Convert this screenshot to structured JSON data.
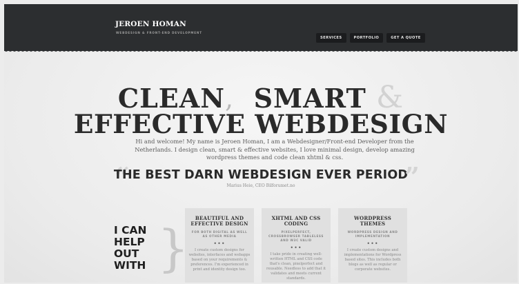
{
  "header": {
    "brand_name": "JEROEN HOMAN",
    "tagline": "WEBDESIGN & FRONT-END DEVELOPMENT",
    "nav": [
      "SERVICES",
      "PORTFOLIO",
      "GET A QUOTE"
    ]
  },
  "hero": {
    "line1_a": "CLEAN",
    "line1_comma": ",",
    "line1_b": "SMART",
    "line1_amp": "&",
    "line2": "EFFECTIVE WEBDESIGN",
    "intro": "Hi and welcome! My name is Jeroen Homan, I am a Webdesigner/Front-end Developer from the Netherlands. I design clean, smart & effective websites, I love minimal design, develop amazing wordpress themes and code clean xhtml & css."
  },
  "testimonial": {
    "open_quote": "“",
    "text": "THE BEST DARN WEBDESIGN EVER PERIOD",
    "close_quote": "”",
    "author": "Marius Heie, CEO Bilforumet.no"
  },
  "services": {
    "heading": [
      "I CAN",
      "HELP",
      "OUT",
      "WITH"
    ],
    "brace": "}",
    "cards": [
      {
        "title": "BEAUTIFUL AND EFFECTIVE DESIGN",
        "subtitle": "FOR BOTH DIGITAL AS WELL AS OTHER MEDIA",
        "dots": "•••",
        "body": "I create custom designs for websites, interfaces and webapps based on your requirements & preferences. I'm experienced in print and identity design too."
      },
      {
        "title": "XHTML AND CSS CODING",
        "subtitle": "PIXELPERFECT, CROSSBROWSER TABLELESS AND W3C VALID",
        "dots": "•••",
        "body": "I take pride in creating well-written HTML and CSS code that's clean, pixelperfect and reusable. Needless to add that it validates and meets current standards."
      },
      {
        "title": "WORDPRESS THEMES",
        "subtitle": "WORDPRESS DESIGN AND IMPLEMENTATION",
        "dots": "•••",
        "body": "I create custom designs and implementations for Wordpress based sites. This includes both blogs as well as regular or corporate websites."
      }
    ]
  }
}
